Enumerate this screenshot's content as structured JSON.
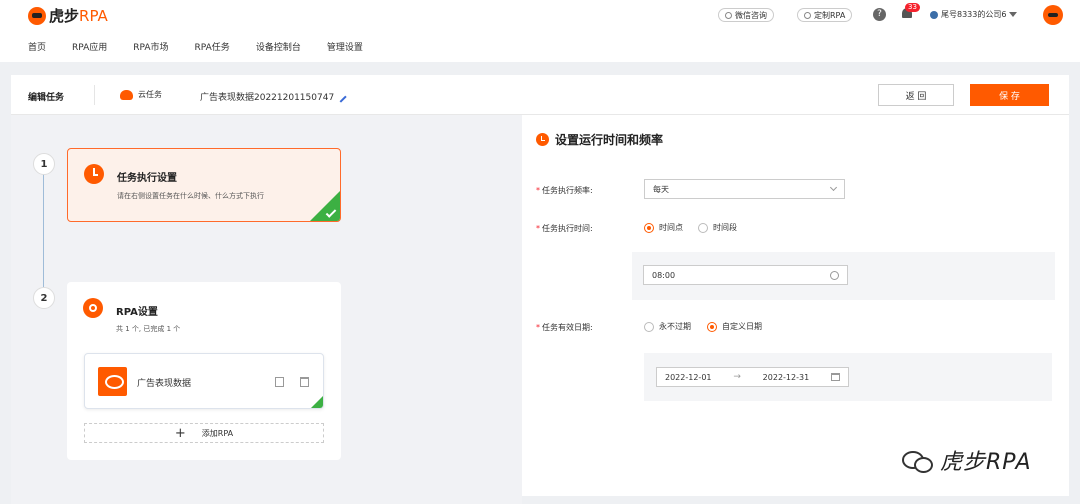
{
  "header": {
    "logo_prefix": "虎步",
    "logo_suffix": "RPA",
    "nav": [
      "首页",
      "RPA应用",
      "RPA市场",
      "RPA任务",
      "设备控制台",
      "管理设置"
    ],
    "wechat_label": "微信咨询",
    "custom_label": "定制RPA",
    "help_label": "?",
    "notify_count": "33",
    "company": "尾号8333的公司6"
  },
  "subbar": {
    "title": "编辑任务",
    "cloud_label": "云任务",
    "task_name": "广告表现数据20221201150747",
    "back_label": "返 回",
    "save_label": "保 存"
  },
  "steps": {
    "step1_num": "1",
    "step2_num": "2",
    "task_title": "任务执行设置",
    "task_desc": "请在右侧设置任务在什么时候、什么方式下执行",
    "rpa_title": "RPA设置",
    "rpa_desc": "共 1 个, 已完成 1 个",
    "rpa_item": "广告表现数据",
    "add_rpa": "添加RPA",
    "add_icon": "+"
  },
  "panel": {
    "title": "设置运行时间和频率",
    "freq_label": "任务执行频率:",
    "freq_value": "每天",
    "time_label": "任务执行时间:",
    "time_opt1": "时间点",
    "time_opt2": "时间段",
    "time_value": "08:00",
    "valid_label": "任务有效日期:",
    "valid_opt1": "永不过期",
    "valid_opt2": "自定义日期",
    "date_start": "2022-12-01",
    "date_arrow": "→",
    "date_end": "2022-12-31",
    "required_mark": "*"
  },
  "footer": {
    "watermark": "虎步RPA"
  },
  "colors": {
    "accent": "#ff5a00",
    "success": "#3cb043",
    "badge": "#f5222d"
  }
}
